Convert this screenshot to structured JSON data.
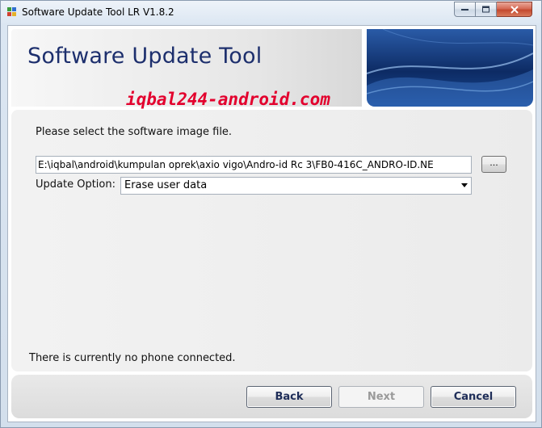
{
  "window": {
    "title": "Software Update Tool LR V1.8.2",
    "controls": [
      "minimize-icon",
      "maximize-icon",
      "close-icon"
    ]
  },
  "banner": {
    "title": "Software Update Tool",
    "watermark": "iqbal244-android.com"
  },
  "form": {
    "prompt": "Please select the software image file.",
    "path_value": "E:\\iqbal\\android\\kumpulan oprek\\axio vigo\\Andro-id Rc 3\\FB0-416C_ANDRO-ID.NE",
    "browse_label": "...",
    "option_label": "Update Option:",
    "option_selected": "Erase user data"
  },
  "status": {
    "message": "There is currently no phone connected."
  },
  "footer": {
    "back_label": "Back",
    "next_label": "Next",
    "cancel_label": "Cancel"
  },
  "colors": {
    "title_blue": "#1d2f6d",
    "watermark_red": "#e3002d",
    "disabled_text": "#9a9a9a"
  }
}
